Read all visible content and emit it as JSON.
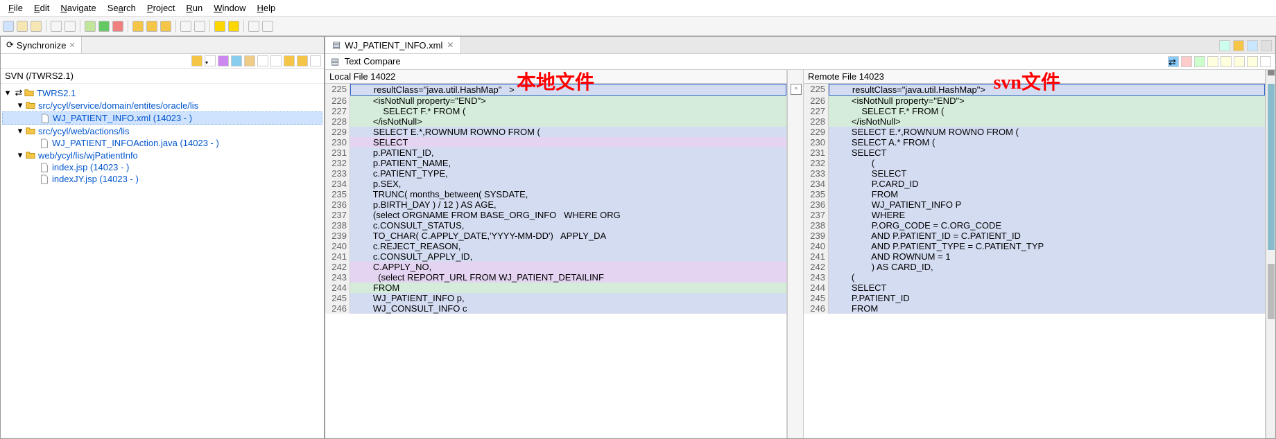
{
  "menubar": [
    "File",
    "Edit",
    "Navigate",
    "Search",
    "Project",
    "Run",
    "Window",
    "Help"
  ],
  "sidebar": {
    "tab": "Synchronize",
    "status": "SVN (/TWRS2.1)",
    "tree": {
      "root": "TWRS2.1",
      "nodes": [
        {
          "label": "src/ycyl/service/domain/entites/oracle/lis",
          "children": [
            {
              "label": "WJ_PATIENT_INFO.xml (14023 -           )",
              "sel": true
            }
          ]
        },
        {
          "label": "src/ycyl/web/actions/lis",
          "children": [
            {
              "label": "WJ_PATIENT_INFOAction.java (14023 -         )"
            }
          ]
        },
        {
          "label": "web/ycyl/lis/wjPatientInfo",
          "children": [
            {
              "label": "index.jsp (14023 -        )"
            },
            {
              "label": "indexJY.jsp (14023 -        )"
            }
          ]
        }
      ]
    }
  },
  "editor": {
    "tab": "WJ_PATIENT_INFO.xml",
    "compare_label": "Text Compare",
    "left_head": "Local File 14022",
    "right_head": "Remote File 14023",
    "anno_left": "本地文件",
    "anno_right": "svn文件"
  },
  "chart_data": {
    "type": "table",
    "left": [
      {
        "n": 225,
        "bg": "blue",
        "cur": true,
        "t": "        resultClass=\"java.util.HashMap\"   >"
      },
      {
        "n": 226,
        "bg": "green",
        "t": "        <isNotNull property=\"END\">"
      },
      {
        "n": 227,
        "bg": "green",
        "t": "            SELECT F.* FROM ("
      },
      {
        "n": 228,
        "bg": "green",
        "t": "        </isNotNull>"
      },
      {
        "n": 229,
        "bg": "blue",
        "t": "        SELECT E.*,ROWNUM ROWNO FROM ("
      },
      {
        "n": 230,
        "bg": "purple",
        "t": "        SELECT"
      },
      {
        "n": 231,
        "bg": "blue",
        "t": "        p.PATIENT_ID,"
      },
      {
        "n": 232,
        "bg": "blue",
        "t": "        p.PATIENT_NAME,"
      },
      {
        "n": 233,
        "bg": "blue",
        "t": "        c.PATIENT_TYPE,"
      },
      {
        "n": 234,
        "bg": "blue",
        "t": "        p.SEX,"
      },
      {
        "n": 235,
        "bg": "blue",
        "t": "        TRUNC( months_between( SYSDATE,"
      },
      {
        "n": 236,
        "bg": "blue",
        "t": "        p.BIRTH_DAY ) / 12 ) AS AGE,"
      },
      {
        "n": 237,
        "bg": "blue",
        "t": "        (select ORGNAME FROM BASE_ORG_INFO   WHERE ORG"
      },
      {
        "n": 238,
        "bg": "blue",
        "t": "        c.CONSULT_STATUS,"
      },
      {
        "n": 239,
        "bg": "blue",
        "t": "        TO_CHAR( C.APPLY_DATE,'YYYY-MM-DD')   APPLY_DA"
      },
      {
        "n": 240,
        "bg": "blue",
        "t": "        c.REJECT_REASON,"
      },
      {
        "n": 241,
        "bg": "blue",
        "t": "        c.CONSULT_APPLY_ID,"
      },
      {
        "n": 242,
        "bg": "purple",
        "t": "        C.APPLY_NO,"
      },
      {
        "n": 243,
        "bg": "purple",
        "t": "          (select REPORT_URL FROM WJ_PATIENT_DETAILINF"
      },
      {
        "n": 244,
        "bg": "green",
        "t": "        FROM"
      },
      {
        "n": 245,
        "bg": "blue",
        "t": "        WJ_PATIENT_INFO p,"
      },
      {
        "n": 246,
        "bg": "blue",
        "t": "        WJ_CONSULT_INFO c"
      }
    ],
    "right": [
      {
        "n": 225,
        "bg": "blue",
        "cur": true,
        "t": "        resultClass=\"java.util.HashMap\">"
      },
      {
        "n": 226,
        "bg": "green",
        "t": "        <isNotNull property=\"END\">"
      },
      {
        "n": 227,
        "bg": "green",
        "t": "            SELECT F.* FROM ("
      },
      {
        "n": 228,
        "bg": "green",
        "t": "        </isNotNull>"
      },
      {
        "n": 229,
        "bg": "blue",
        "t": "        SELECT E.*,ROWNUM ROWNO FROM ("
      },
      {
        "n": 230,
        "bg": "blue",
        "t": "        SELECT A.* FROM ("
      },
      {
        "n": 231,
        "bg": "blue",
        "t": "        SELECT"
      },
      {
        "n": 232,
        "bg": "blue",
        "t": "                ("
      },
      {
        "n": 233,
        "bg": "blue",
        "t": "                SELECT"
      },
      {
        "n": 234,
        "bg": "blue",
        "t": "                P.CARD_ID"
      },
      {
        "n": 235,
        "bg": "blue",
        "t": "                FROM"
      },
      {
        "n": 236,
        "bg": "blue",
        "t": "                WJ_PATIENT_INFO P"
      },
      {
        "n": 237,
        "bg": "blue",
        "t": "                WHERE"
      },
      {
        "n": 238,
        "bg": "blue",
        "t": "                P.ORG_CODE = C.ORG_CODE"
      },
      {
        "n": 239,
        "bg": "blue",
        "t": "                AND P.PATIENT_ID = C.PATIENT_ID"
      },
      {
        "n": 240,
        "bg": "blue",
        "t": "                AND P.PATIENT_TYPE = C.PATIENT_TYP"
      },
      {
        "n": 241,
        "bg": "blue",
        "t": "                AND ROWNUM = 1"
      },
      {
        "n": 242,
        "bg": "blue",
        "t": "                ) AS CARD_ID,"
      },
      {
        "n": 243,
        "bg": "blue",
        "t": "        ("
      },
      {
        "n": 244,
        "bg": "blue",
        "t": "        SELECT"
      },
      {
        "n": 245,
        "bg": "blue",
        "t": "        P.PATIENT_ID"
      },
      {
        "n": 246,
        "bg": "blue",
        "t": "        FROM"
      }
    ]
  }
}
